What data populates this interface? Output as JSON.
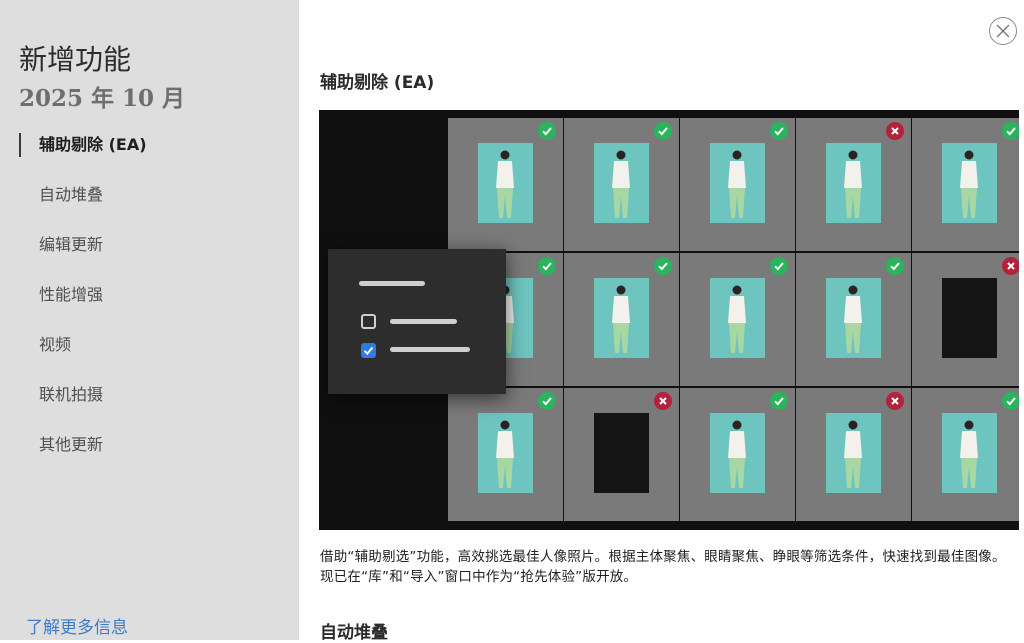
{
  "sidebar": {
    "title": "新增功能",
    "subtitle": "2025 年 10 月",
    "items": [
      {
        "label": "辅助剔除 (EA)",
        "active": true
      },
      {
        "label": "自动堆叠",
        "active": false
      },
      {
        "label": "编辑更新",
        "active": false
      },
      {
        "label": "性能增强",
        "active": false
      },
      {
        "label": "视频",
        "active": false
      },
      {
        "label": "联机拍摄",
        "active": false
      },
      {
        "label": "其他更新",
        "active": false
      }
    ],
    "learn_more": "了解更多信息"
  },
  "main": {
    "section_title": "辅助剔除 (EA)",
    "description": "借助“辅助剔选”功能，高效挑选最佳人像照片。根据主体聚焦、眼睛聚焦、睁眼等筛选条件，快速找到最佳图像。现已在“库”和“导入”窗口中作为“抢先体验”版开放。",
    "next_section_title": "自动堆叠"
  },
  "hero": {
    "rows": [
      [
        "keep",
        "keep",
        "keep",
        "reject",
        "keep"
      ],
      [
        "keep",
        "keep",
        "keep",
        "keep",
        "reject"
      ],
      [
        "keep",
        "reject",
        "keep",
        "reject",
        "keep"
      ]
    ],
    "dark_tiles": [
      [
        1,
        4
      ],
      [
        2,
        1
      ]
    ],
    "filter_panel": {
      "checkboxes": [
        {
          "checked": false
        },
        {
          "checked": true
        }
      ]
    }
  },
  "icons": {
    "close": "close-icon",
    "keep": "checkmark-icon",
    "reject": "x-mark-icon"
  },
  "colors": {
    "keep": "#29b45d",
    "reject": "#b3223a",
    "checkbox_on": "#2f7ae5",
    "link": "#3e7cc7",
    "photo_bg": "#6ec4bf"
  }
}
